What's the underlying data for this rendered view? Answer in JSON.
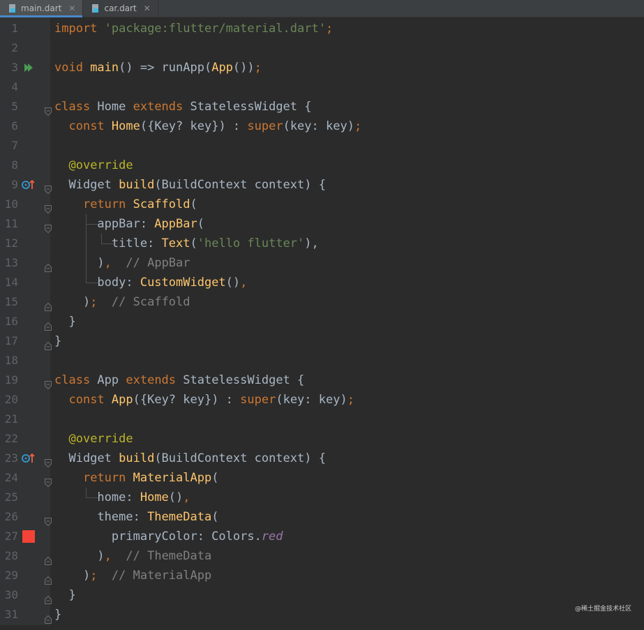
{
  "tabs": [
    {
      "label": "main.dart",
      "active": true
    },
    {
      "label": "car.dart",
      "active": false
    }
  ],
  "lines": [
    {
      "n": "1",
      "tokens": [
        [
          "k",
          "import "
        ],
        [
          "s",
          "'package:flutter/material.dart'"
        ],
        [
          "k",
          ";"
        ]
      ]
    },
    {
      "n": "2",
      "tokens": []
    },
    {
      "n": "3",
      "marker": "run",
      "tokens": [
        [
          "k",
          "void "
        ],
        [
          "f",
          "main"
        ],
        [
          "",
          "() => runApp("
        ],
        [
          "f",
          "App"
        ],
        [
          "",
          "())"
        ],
        [
          "k",
          ";"
        ]
      ]
    },
    {
      "n": "4",
      "tokens": []
    },
    {
      "n": "5",
      "fold": "open",
      "tokens": [
        [
          "k",
          "class "
        ],
        [
          "",
          "Home "
        ],
        [
          "k",
          "extends "
        ],
        [
          "",
          "StatelessWidget {"
        ]
      ]
    },
    {
      "n": "6",
      "tokens": [
        [
          "",
          "  "
        ],
        [
          "k",
          "const "
        ],
        [
          "f",
          "Home"
        ],
        [
          "",
          "({Key? key}) : "
        ],
        [
          "k",
          "super"
        ],
        [
          "",
          "(key: key)"
        ],
        [
          "k",
          ";"
        ]
      ]
    },
    {
      "n": "7",
      "tokens": []
    },
    {
      "n": "8",
      "tokens": [
        [
          "",
          "  "
        ],
        [
          "a",
          "@override"
        ]
      ]
    },
    {
      "n": "9",
      "marker": "override",
      "fold": "open",
      "tokens": [
        [
          "",
          "  Widget "
        ],
        [
          "f",
          "build"
        ],
        [
          "",
          "(BuildContext context) {"
        ]
      ]
    },
    {
      "n": "10",
      "fold": "open",
      "tokens": [
        [
          "",
          "    "
        ],
        [
          "k",
          "return "
        ],
        [
          "f",
          "Scaffold"
        ],
        [
          "",
          "("
        ]
      ]
    },
    {
      "n": "11",
      "fold": "open",
      "tokens": [
        [
          "",
          "      appBar: "
        ],
        [
          "f",
          "AppBar"
        ],
        [
          "",
          "("
        ]
      ]
    },
    {
      "n": "12",
      "tokens": [
        [
          "",
          "        title: "
        ],
        [
          "f",
          "Text"
        ],
        [
          "",
          "("
        ],
        [
          "s",
          "'hello flutter'"
        ],
        [
          "",
          "),"
        ]
      ]
    },
    {
      "n": "13",
      "fold": "close",
      "tokens": [
        [
          "",
          "      )"
        ],
        [
          "k",
          ","
        ],
        [
          "",
          "  "
        ],
        [
          "c",
          "// AppBar"
        ]
      ]
    },
    {
      "n": "14",
      "tokens": [
        [
          "",
          "      body: "
        ],
        [
          "f",
          "CustomWidget"
        ],
        [
          "",
          "()"
        ],
        [
          "k",
          ","
        ]
      ]
    },
    {
      "n": "15",
      "fold": "close",
      "tokens": [
        [
          "",
          "    )"
        ],
        [
          "k",
          ";"
        ],
        [
          "",
          "  "
        ],
        [
          "c",
          "// Scaffold"
        ]
      ]
    },
    {
      "n": "16",
      "fold": "close",
      "tokens": [
        [
          "",
          "  }"
        ]
      ]
    },
    {
      "n": "17",
      "fold": "close",
      "tokens": [
        [
          "",
          "}"
        ]
      ]
    },
    {
      "n": "18",
      "tokens": []
    },
    {
      "n": "19",
      "fold": "open",
      "tokens": [
        [
          "k",
          "class "
        ],
        [
          "",
          "App "
        ],
        [
          "k",
          "extends "
        ],
        [
          "",
          "StatelessWidget {"
        ]
      ]
    },
    {
      "n": "20",
      "tokens": [
        [
          "",
          "  "
        ],
        [
          "k",
          "const "
        ],
        [
          "f",
          "App"
        ],
        [
          "",
          "({Key? key}) : "
        ],
        [
          "k",
          "super"
        ],
        [
          "",
          "(key: key)"
        ],
        [
          "k",
          ";"
        ]
      ]
    },
    {
      "n": "21",
      "tokens": []
    },
    {
      "n": "22",
      "tokens": [
        [
          "",
          "  "
        ],
        [
          "a",
          "@override"
        ]
      ]
    },
    {
      "n": "23",
      "marker": "override",
      "fold": "open",
      "tokens": [
        [
          "",
          "  Widget "
        ],
        [
          "f",
          "build"
        ],
        [
          "",
          "(BuildContext context) {"
        ]
      ]
    },
    {
      "n": "24",
      "fold": "open",
      "tokens": [
        [
          "",
          "    "
        ],
        [
          "k",
          "return "
        ],
        [
          "f",
          "MaterialApp"
        ],
        [
          "",
          "("
        ]
      ]
    },
    {
      "n": "25",
      "tokens": [
        [
          "",
          "      home: "
        ],
        [
          "f",
          "Home"
        ],
        [
          "",
          "()"
        ],
        [
          "k",
          ","
        ]
      ]
    },
    {
      "n": "26",
      "fold": "open",
      "tokens": [
        [
          "",
          "      theme: "
        ],
        [
          "f",
          "ThemeData"
        ],
        [
          "",
          "("
        ]
      ]
    },
    {
      "n": "27",
      "marker": "color",
      "tokens": [
        [
          "",
          "        primaryColor: Colors."
        ],
        [
          "i",
          "red"
        ]
      ]
    },
    {
      "n": "28",
      "fold": "close",
      "tokens": [
        [
          "",
          "      )"
        ],
        [
          "k",
          ","
        ],
        [
          "",
          "  "
        ],
        [
          "c",
          "// ThemeData"
        ]
      ]
    },
    {
      "n": "29",
      "fold": "close",
      "tokens": [
        [
          "",
          "    )"
        ],
        [
          "k",
          ";"
        ],
        [
          "",
          "  "
        ],
        [
          "c",
          "// MaterialApp"
        ]
      ]
    },
    {
      "n": "30",
      "fold": "close",
      "tokens": [
        [
          "",
          "  }"
        ]
      ]
    },
    {
      "n": "31",
      "fold": "close",
      "tokens": [
        [
          "",
          "}"
        ]
      ]
    }
  ],
  "colors": {
    "background": "#2b2b2b",
    "keyword": "#cc7832",
    "string": "#6a8759",
    "function": "#ffc66d",
    "comment": "#808080",
    "annotation": "#bbb529",
    "swatch_red": "#f44336"
  },
  "watermark": "@稀土掘金技术社区"
}
